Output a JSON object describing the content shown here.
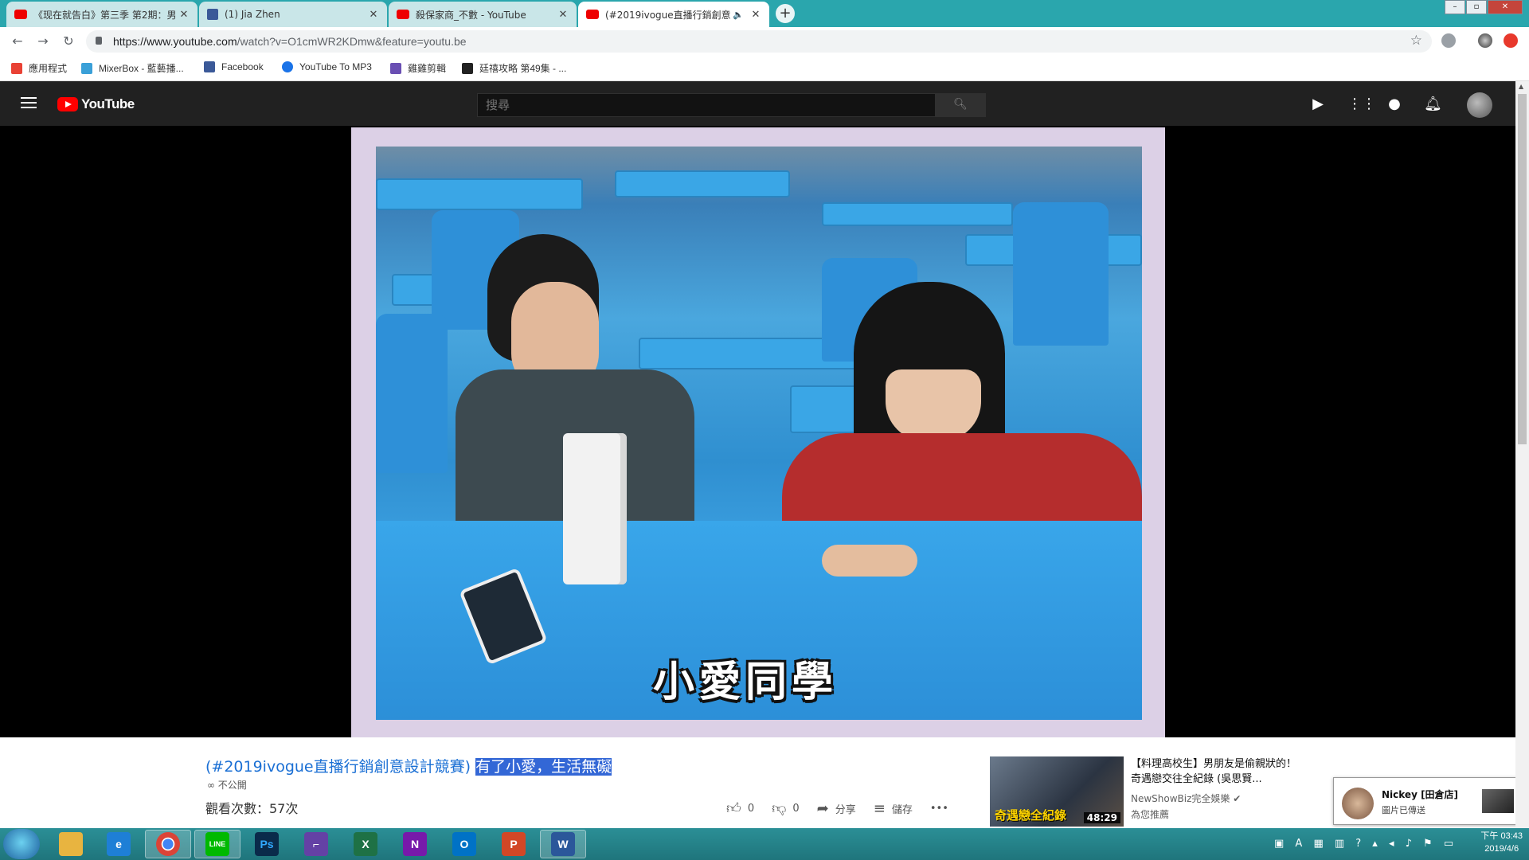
{
  "browser": {
    "tabs": [
      {
        "label": "《现在就告白》第三季 第2期：男",
        "icon": "youtube-icon"
      },
      {
        "label": "(1) Jia Zhen",
        "icon": "facebook-icon"
      },
      {
        "label": "殺保家商_不數 - YouTube",
        "icon": "youtube-icon"
      },
      {
        "label": "(#2019ivogue直播行銷創意",
        "icon": "youtube-icon",
        "audio": "speaker-icon"
      }
    ],
    "new_tab": "+",
    "url_host": "https://www.youtube.com",
    "url_path": "/watch?v=O1cmWR2KDmw&feature=youtu.be",
    "bookmarks": [
      {
        "label": "應用程式",
        "color": "#e94235"
      },
      {
        "label": "MixerBox - 藍藝播...",
        "color": "#3aa0d8"
      },
      {
        "label": "Facebook",
        "color": "#3b5998"
      },
      {
        "label": "YouTube To MP3",
        "color": "#1a73e8"
      },
      {
        "label": "雞雞剪輯",
        "color": "#6a4fb3"
      },
      {
        "label": "廷禧攻略 第49集 - ...",
        "color": "#222222"
      }
    ]
  },
  "youtube": {
    "logo_text": "YouTube",
    "search_placeholder": "搜尋",
    "video": {
      "caption": "小愛同學",
      "title_prefix": "(#2019ivogue直播行銷創意設計競賽)",
      "title_selected": "有了小愛，生活無礙",
      "visibility": "∞ 不公開",
      "views": "觀看次數：57次",
      "likes": "0",
      "dislikes": "0",
      "share_label": "分享",
      "save_label": "儲存",
      "more_label": "•••"
    },
    "recommendation": {
      "title": "【料理高校生】男朋友是偷親狀的！奇遇戀交往全紀錄 (吳思賢...",
      "channel": "NewShowBiz完全娛樂",
      "reason": "為您推薦",
      "duration": "48:29",
      "thumb_tag": "奇遇戀全紀錄"
    }
  },
  "notification": {
    "name": "Nickey [田倉店]",
    "message": "圖片已傳送"
  },
  "taskbar": {
    "apps": [
      {
        "name": "file-explorer",
        "label": "",
        "color": "#e8b440"
      },
      {
        "name": "internet-explorer",
        "label": "e",
        "color": "#1e7fd6"
      },
      {
        "name": "chrome",
        "label": "",
        "color": "#db4437"
      },
      {
        "name": "line",
        "label": "LINE",
        "color": "#00b900"
      },
      {
        "name": "photoshop",
        "label": "Ps",
        "color": "#0a2a4a"
      },
      {
        "name": "twitch",
        "label": "⌐",
        "color": "#6441a5"
      },
      {
        "name": "excel",
        "label": "X",
        "color": "#1e7145"
      },
      {
        "name": "onenote",
        "label": "N",
        "color": "#7719aa"
      },
      {
        "name": "outlook",
        "label": "O",
        "color": "#0072c6"
      },
      {
        "name": "powerpoint",
        "label": "P",
        "color": "#d24726"
      },
      {
        "name": "word",
        "label": "W",
        "color": "#2b579a"
      }
    ],
    "time": "下午 03:43",
    "date": "2019/4/6"
  }
}
